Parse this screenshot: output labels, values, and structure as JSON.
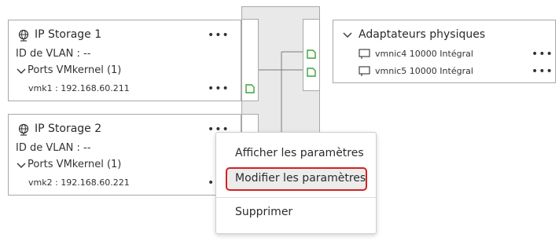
{
  "pg1": {
    "title": "IP Storage 1",
    "vlan": "ID de VLAN : --",
    "ports_label": "Ports VMkernel (1)",
    "vmk": "vmk1 : 192.168.60.211",
    "more": "•••"
  },
  "pg2": {
    "title": "IP Storage 2",
    "vlan": "ID de VLAN : --",
    "ports_label": "Ports VMkernel (1)",
    "vmk": "vmk2 : 192.168.60.221",
    "more": "•••"
  },
  "adapters": {
    "title": "Adaptateurs physiques",
    "items": [
      {
        "label": "vmnic4 10000 Intégral",
        "more": "•••"
      },
      {
        "label": "vmnic5 10000 Intégral",
        "more": "•••"
      }
    ]
  },
  "menu": {
    "view": "Afficher les paramètres",
    "edit": "Modifier les paramètres",
    "delete": "Supprimer"
  },
  "colors": {
    "port_green": "#3aa33a",
    "highlight_red": "#d62020",
    "border": "#a8a8a8"
  }
}
